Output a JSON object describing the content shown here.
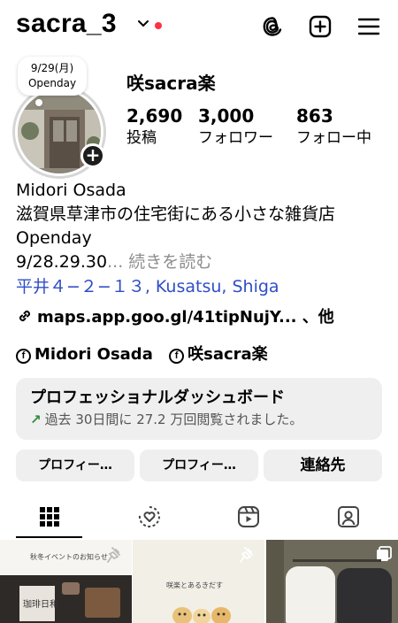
{
  "header": {
    "username": "sacra_3"
  },
  "profile": {
    "note_line1": "9/29(月)",
    "note_line2": "Openday",
    "display_name": "咲sacra楽",
    "posts_count": "2,690",
    "posts_label": "投稿",
    "followers_count": "3,000",
    "followers_label": "フォロワー",
    "following_count": "863",
    "following_label": "フォロー中"
  },
  "bio": {
    "name": "Midori Osada",
    "line1": "滋賀県草津市の住宅街にある小さな雑貨店",
    "line2": "Openday",
    "line3": "9/28.29.30",
    "more": "... 続きを読む",
    "location": "平井４−２−１３, Kusatsu, Shiga",
    "link": "maps.app.goo.gl/41tipNujY... 、他",
    "fb_name": "Midori  Osada",
    "fb_page": "咲sacra楽"
  },
  "dashboard": {
    "title": "プロフェッショナルダッシュボード",
    "subtitle": "過去 30日間に 27.2 万回閲覧されました。"
  },
  "buttons": {
    "edit_profile": "プロフィー…",
    "share_profile": "プロフィー…",
    "contact": "連絡先"
  },
  "grid": {
    "post1_caption": "秋冬イベントのお知らせ",
    "post1_art": "珈琲日和",
    "post2_caption": "咲楽とあるきだす"
  },
  "colors": {
    "notification_dot": "#ff3040",
    "location_link": "#2f4ec6",
    "trend_arrow": "#2e8b3d",
    "button_bg": "#efefef"
  },
  "icons": {
    "threads": "threads-icon",
    "create": "plus-square-icon",
    "menu": "hamburger-menu-icon",
    "link": "link-icon",
    "facebook": "facebook-icon"
  }
}
